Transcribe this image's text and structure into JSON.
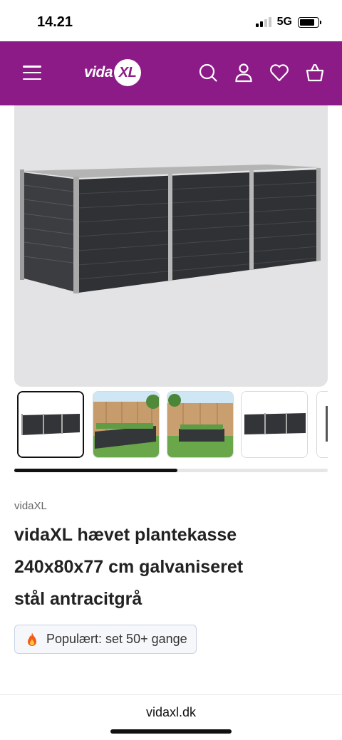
{
  "status_bar": {
    "time": "14.21",
    "network": "5G"
  },
  "header": {
    "logo_text": "vida",
    "logo_badge": "XL",
    "brand_color": "#8c1b87",
    "icons": [
      "menu-icon",
      "search-icon",
      "account-icon",
      "heart-icon",
      "basket-icon"
    ]
  },
  "gallery": {
    "thumbnail_count": 5,
    "active_thumbnail": 1,
    "scroll_progress": 0.52
  },
  "product": {
    "brand": "vidaXL",
    "title_lines": [
      "vidaXL hævet plantekasse",
      "240x80x77 cm galvaniseret",
      "stål antracitgrå"
    ],
    "popularity": "Populært: set 50+ gange",
    "popularity_icon": "fire-icon"
  },
  "browser": {
    "url": "vidaxl.dk"
  }
}
